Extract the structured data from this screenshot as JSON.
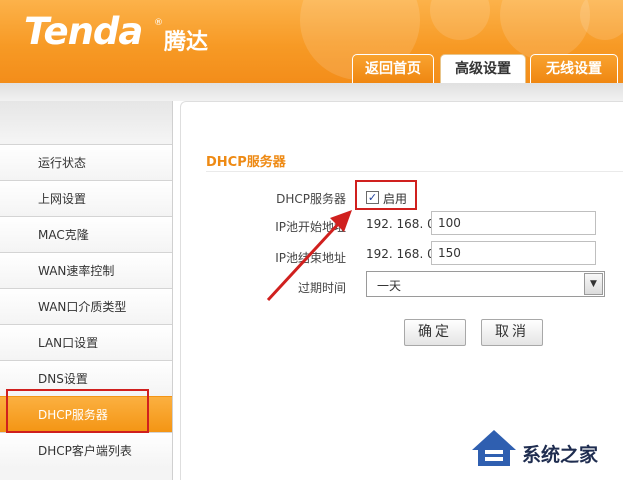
{
  "brand": {
    "name": "Tenda",
    "name_cn": "腾达",
    "reg_mark": "®"
  },
  "tabs": [
    {
      "label": "返回首页"
    },
    {
      "label": "高级设置",
      "active": true
    },
    {
      "label": "无线设置"
    }
  ],
  "sidebar": {
    "items": [
      {
        "label": "运行状态"
      },
      {
        "label": "上网设置"
      },
      {
        "label": "MAC克隆"
      },
      {
        "label": "WAN速率控制"
      },
      {
        "label": "WAN口介质类型"
      },
      {
        "label": "LAN口设置"
      },
      {
        "label": "DNS设置"
      },
      {
        "label": "DHCP服务器",
        "active": true
      },
      {
        "label": "DHCP客户端列表"
      }
    ]
  },
  "dhcp": {
    "title": "DHCP服务器",
    "server_label": "DHCP服务器",
    "enable_label": "启用",
    "enabled": true,
    "start_label": "IP池开始地址",
    "end_label": "IP池结束地址",
    "ip_prefix": "192. 168. 0.",
    "start_value": "100",
    "end_value": "150",
    "lease_label": "过期时间",
    "lease_value": "一天"
  },
  "buttons": {
    "ok": "确定",
    "cancel": "取消"
  },
  "watermark": {
    "text": "系统之家"
  },
  "colors": {
    "accent": "#f79a25",
    "highlight": "#d0201e",
    "title": "#ee8a14"
  }
}
